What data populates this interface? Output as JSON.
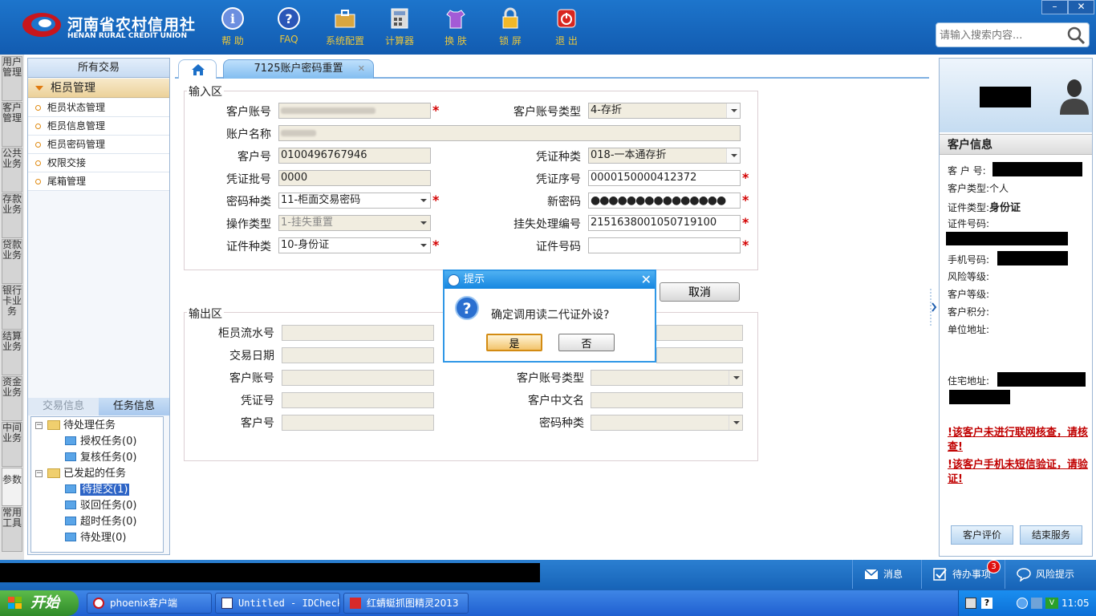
{
  "brand": {
    "name_cn": "河南省农村信用社",
    "name_en": "HENAN RURAL CREDIT UNION",
    "color": "#1869c0"
  },
  "toolbar": [
    {
      "label": "帮 助",
      "icon": "info-icon"
    },
    {
      "label": "FAQ",
      "icon": "faq-icon"
    },
    {
      "label": "系统配置",
      "icon": "toolbox-icon"
    },
    {
      "label": "计算器",
      "icon": "calculator-icon"
    },
    {
      "label": "换 肤",
      "icon": "shirt-icon"
    },
    {
      "label": "锁 屏",
      "icon": "lock-icon"
    },
    {
      "label": "退 出",
      "icon": "power-icon"
    }
  ],
  "window_controls": {
    "minimize": "–",
    "close": "✕"
  },
  "search": {
    "placeholder": "请输入搜索内容..."
  },
  "vertical_tabs": [
    "用户管理",
    "客户管理",
    "公共业务",
    "存款业务",
    "贷款业务",
    "银行卡业务",
    "结算业务",
    "资金业务",
    "中间业务",
    "参数",
    "常用工具"
  ],
  "left_panel": {
    "all_transactions": "所有交易",
    "group": "柜员管理",
    "items": [
      "柜员状态管理",
      "柜员信息管理",
      "柜员密码管理",
      "权限交接",
      "尾箱管理"
    ],
    "task_tabs": [
      "交易信息",
      "任务信息"
    ],
    "tree": {
      "pending": {
        "label": "待处理任务",
        "children": [
          "授权任务(0)",
          "复核任务(0)"
        ]
      },
      "initiated": {
        "label": "已发起的任务",
        "children": [
          "待提交(1)",
          "驳回任务(0)",
          "超时任务(0)",
          "待处理(0)"
        ]
      }
    }
  },
  "tab": {
    "title": "7125账户密码重置",
    "close": "✕"
  },
  "input_section": {
    "legend": "输入区",
    "fields": {
      "customer_account": {
        "label": "客户账号"
      },
      "account_type": {
        "label": "客户账号类型",
        "value": "4-存折"
      },
      "account_name": {
        "label": "账户名称"
      },
      "customer_no": {
        "label": "客户号",
        "value": "0100496767946"
      },
      "voucher_kind": {
        "label": "凭证种类",
        "value": "018-一本通存折"
      },
      "voucher_batch": {
        "label": "凭证批号",
        "value": "0000"
      },
      "voucher_seq": {
        "label": "凭证序号",
        "value": "0000150000412372"
      },
      "password_kind": {
        "label": "密码种类",
        "value": "11-柜面交易密码"
      },
      "new_password": {
        "label": "新密码",
        "value": "●●●●●●●●●●●●●●●"
      },
      "operation_type": {
        "label": "操作类型",
        "value": "1-挂失重置"
      },
      "loss_report_no": {
        "label": "挂失处理编号",
        "value": "2151638001050719100"
      },
      "id_kind": {
        "label": "证件种类",
        "value": "10-身份证"
      },
      "id_number": {
        "label": "证件号码",
        "value": ""
      }
    },
    "required_mark": "*"
  },
  "cancel_button": "取消",
  "output_section": {
    "legend": "输出区",
    "labels": [
      "柜员流水号",
      "交易日期",
      "客户账号",
      "凭证号",
      "客户号"
    ],
    "right_labels": [
      "客户账号类型",
      "客户中文名",
      "密码种类"
    ]
  },
  "dialog": {
    "title": "提示",
    "message": "确定调用读二代证外设?",
    "yes": "是",
    "no": "否",
    "close": "✕"
  },
  "customer_info": {
    "header": "客户信息",
    "labels": {
      "customer_no": "客 户 号:",
      "customer_type": "客户类型:",
      "id_type": "证件类型:",
      "id_number": "证件号码:",
      "phone": "手机号码:",
      "risk_level": "风险等级:",
      "customer_level": "客户等级:",
      "points": "客户积分:",
      "work_address": "单位地址:",
      "home_address": "住宅地址:"
    },
    "values": {
      "customer_type": "个人",
      "id_type": "身份证"
    },
    "warnings": [
      "!该客户未进行联网核查，请核查!",
      "!该客户手机未短信验证，请验证!"
    ],
    "buttons": [
      "客户评价",
      "结束服务"
    ]
  },
  "statusbar": {
    "messages": "消息",
    "todo": "待办事项",
    "todo_count": "3",
    "risk": "风险提示"
  },
  "taskbar": {
    "start": "开始",
    "tasks": [
      "phoenix客户端",
      "Untitled - IDCheck",
      "红蜻蜓抓图精灵2013"
    ],
    "clock": "11:05"
  }
}
